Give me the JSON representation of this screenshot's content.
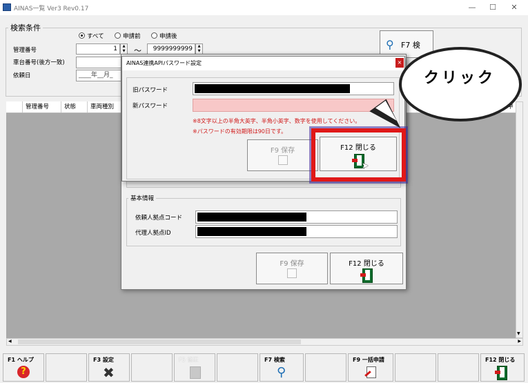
{
  "window": {
    "title": "AINAS一覧 Ver3 Rev0.17",
    "controls": [
      "—",
      "☐",
      "✕"
    ]
  },
  "search": {
    "group_title": "検索条件",
    "radio_options": [
      {
        "label": "すべて",
        "selected": true
      },
      {
        "label": "申請前",
        "selected": false
      },
      {
        "label": "申請後",
        "selected": false
      }
    ],
    "kanri_label": "管理番号",
    "kanri_from": "1",
    "kanri_to": "9999999999",
    "range_sep": "〜",
    "shadai_label": "車台番号(後方一致)",
    "irai_label": "依頼日",
    "date_placeholder": "____年__月_",
    "f7_search_label": "F7 検"
  },
  "grid": {
    "columns": [
      "管理番号",
      "状態",
      "車両種別"
    ],
    "right_column": "甲"
  },
  "outer_dialog": {
    "kihon_title": "基本情報",
    "irai_code_label": "依頼人拠点コード",
    "dairi_id_label": "代理人拠点ID",
    "save_label": "F9 保存",
    "close_label": "F12 閉じる"
  },
  "pw_dialog": {
    "title": "AINAS連携APIパスワード設定",
    "old_pw_label": "旧パスワード",
    "new_pw_label": "新パスワード",
    "note1": "※8文字以上の半角大英字、半角小英字、数字を使用してください。",
    "note2": "※パスワードの有効期限は90日です。",
    "save_label": "F9 保存",
    "close_label": "F12 閉じる",
    "close_x": "×"
  },
  "annotation": {
    "callout_text": "クリック",
    "highlight_color": "#e01818"
  },
  "fkeys": [
    {
      "label": "F1 ヘルプ",
      "icon": "help-icon",
      "enabled": true
    },
    {
      "label": "",
      "icon": "",
      "enabled": true
    },
    {
      "label": "F3 設定",
      "icon": "settings-tools-icon",
      "enabled": true
    },
    {
      "label": "",
      "icon": "",
      "enabled": true
    },
    {
      "label": "F5 修正",
      "icon": "edit-icon",
      "enabled": false
    },
    {
      "label": "",
      "icon": "",
      "enabled": true
    },
    {
      "label": "F7 検索",
      "icon": "search-icon",
      "enabled": true
    },
    {
      "label": "",
      "icon": "",
      "enabled": true
    },
    {
      "label": "F9 一括申請",
      "icon": "bulk-apply-icon",
      "enabled": true
    },
    {
      "label": "",
      "icon": "",
      "enabled": true
    },
    {
      "label": "",
      "icon": "",
      "enabled": true
    },
    {
      "label": "F12 閉じる",
      "icon": "exit-door-icon",
      "enabled": true
    }
  ]
}
